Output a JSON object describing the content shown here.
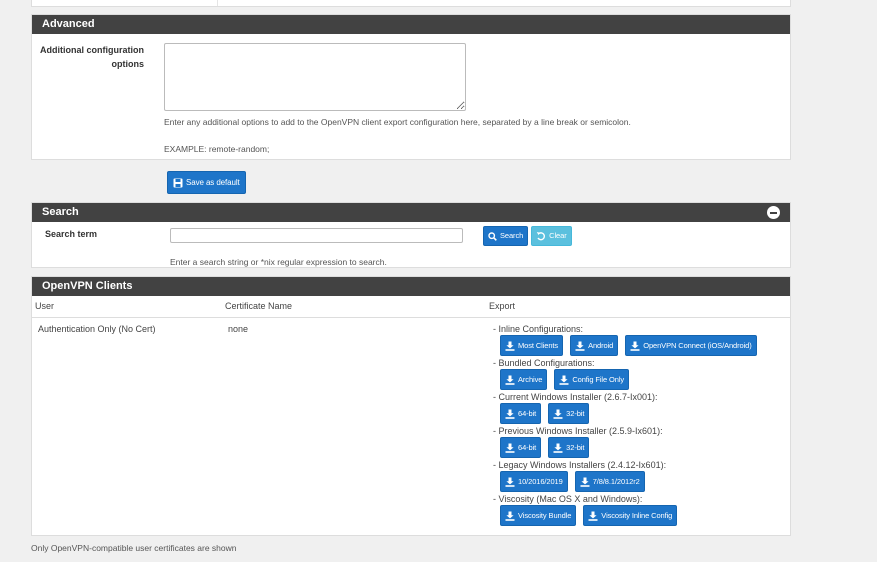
{
  "advanced": {
    "heading": "Advanced",
    "label_line1": "Additional configuration",
    "label_line2": "options",
    "textarea_value": "",
    "help": "Enter any additional options to add to the OpenVPN client export configuration here, separated by a line break or semicolon.",
    "example": "EXAMPLE: remote-random;"
  },
  "save_button": {
    "label": "Save as default",
    "icon": "save-icon"
  },
  "search": {
    "heading": "Search",
    "label": "Search term",
    "input_value": "",
    "help": "Enter a search string or *nix regular expression to search.",
    "search_label": "Search",
    "clear_label": "Clear"
  },
  "clients": {
    "heading": "OpenVPN Clients",
    "columns": {
      "user": "User",
      "cert": "Certificate Name",
      "export": "Export"
    },
    "row": {
      "user": "Authentication Only (No Cert)",
      "cert": "none"
    },
    "groups": [
      {
        "label": "- Inline Configurations:",
        "buttons": [
          "Most Clients",
          "Android",
          "OpenVPN Connect (iOS/Android)"
        ]
      },
      {
        "label": "- Bundled Configurations:",
        "buttons": [
          "Archive",
          "Config File Only"
        ]
      },
      {
        "label": "- Current Windows Installer (2.6.7-Ix001):",
        "buttons": [
          "64-bit",
          "32-bit"
        ]
      },
      {
        "label": "- Previous Windows Installer (2.5.9-Ix601):",
        "buttons": [
          "64-bit",
          "32-bit"
        ]
      },
      {
        "label": "- Legacy Windows Installers (2.4.12-Ix601):",
        "buttons": [
          "10/2016/2019",
          "7/8/8.1/2012r2"
        ]
      },
      {
        "label": "- Viscosity (Mac OS X and Windows):",
        "buttons": [
          "Viscosity Bundle",
          "Viscosity Inline Config"
        ]
      }
    ]
  },
  "footnote": "Only OpenVPN-compatible user certificates are shown",
  "colors": {
    "primary": "#1e75c9",
    "info": "#5bc0de",
    "heading": "#424242"
  }
}
